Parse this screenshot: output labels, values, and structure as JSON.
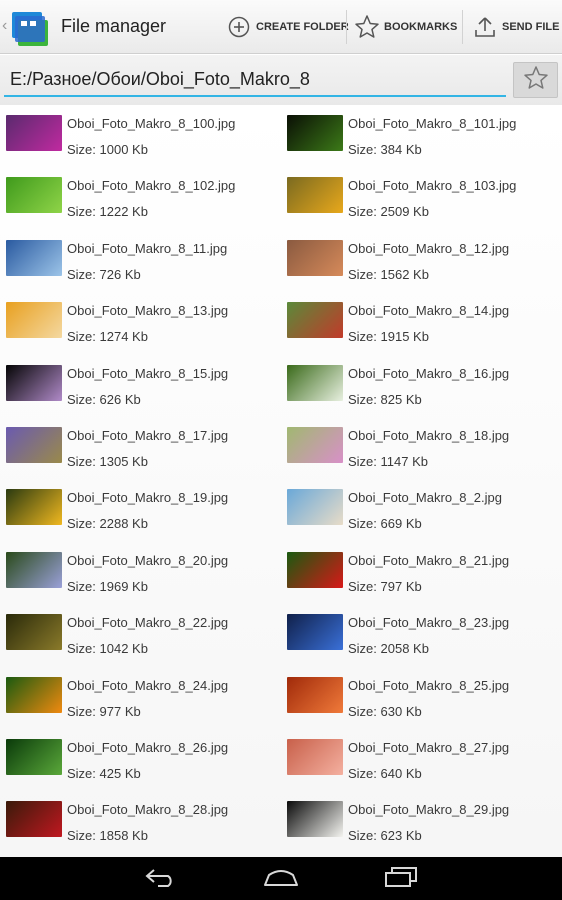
{
  "app": {
    "title": "File manager",
    "icon": "folder-app-icon"
  },
  "toolbar": {
    "create_folder_label": "CREATE FOLDER",
    "bookmarks_label": "BOOKMARKS",
    "send_file_label": "SEND FILE"
  },
  "pathbar": {
    "path": "E:/Разное/Обои/Oboi_Foto_Makro_8",
    "bookmark_icon": "star-outline-icon"
  },
  "files": [
    {
      "name": "Oboi_Foto_Makro_8_100.jpg",
      "size": "Size: 1000 Kb",
      "thumb_colors": [
        "#5a2a6e",
        "#c02aa0"
      ]
    },
    {
      "name": "Oboi_Foto_Makro_8_101.jpg",
      "size": "Size: 384 Kb",
      "thumb_colors": [
        "#0a0f05",
        "#3c7a18"
      ]
    },
    {
      "name": "Oboi_Foto_Makro_8_102.jpg",
      "size": "Size: 1222 Kb",
      "thumb_colors": [
        "#3f9a1c",
        "#8fd448"
      ]
    },
    {
      "name": "Oboi_Foto_Makro_8_103.jpg",
      "size": "Size: 2509 Kb",
      "thumb_colors": [
        "#7a6a20",
        "#e8a81c"
      ]
    },
    {
      "name": "Oboi_Foto_Makro_8_11.jpg",
      "size": "Size: 726 Kb",
      "thumb_colors": [
        "#2a5aa0",
        "#9cc4e8"
      ]
    },
    {
      "name": "Oboi_Foto_Makro_8_12.jpg",
      "size": "Size: 1562 Kb",
      "thumb_colors": [
        "#8a5a40",
        "#d68a5a"
      ]
    },
    {
      "name": "Oboi_Foto_Makro_8_13.jpg",
      "size": "Size: 1274 Kb",
      "thumb_colors": [
        "#e8a020",
        "#f4d8a0"
      ]
    },
    {
      "name": "Oboi_Foto_Makro_8_14.jpg",
      "size": "Size: 1915 Kb",
      "thumb_colors": [
        "#5a8a3a",
        "#c23a2a"
      ]
    },
    {
      "name": "Oboi_Foto_Makro_8_15.jpg",
      "size": "Size: 626 Kb",
      "thumb_colors": [
        "#050505",
        "#b08ac8"
      ]
    },
    {
      "name": "Oboi_Foto_Makro_8_16.jpg",
      "size": "Size: 825 Kb",
      "thumb_colors": [
        "#3a6a1a",
        "#e8f0e0"
      ]
    },
    {
      "name": "Oboi_Foto_Makro_8_17.jpg",
      "size": "Size: 1305 Kb",
      "thumb_colors": [
        "#6a5ab0",
        "#9a8a4a"
      ]
    },
    {
      "name": "Oboi_Foto_Makro_8_18.jpg",
      "size": "Size: 1147 Kb",
      "thumb_colors": [
        "#a0b870",
        "#d890c8"
      ]
    },
    {
      "name": "Oboi_Foto_Makro_8_19.jpg",
      "size": "Size: 2288 Kb",
      "thumb_colors": [
        "#2a3a10",
        "#f0b820"
      ]
    },
    {
      "name": "Oboi_Foto_Makro_8_2.jpg",
      "size": "Size: 669 Kb",
      "thumb_colors": [
        "#6aa8d8",
        "#e8dcc8"
      ]
    },
    {
      "name": "Oboi_Foto_Makro_8_20.jpg",
      "size": "Size: 1969 Kb",
      "thumb_colors": [
        "#2a4a1a",
        "#9aa0d8"
      ]
    },
    {
      "name": "Oboi_Foto_Makro_8_21.jpg",
      "size": "Size: 797 Kb",
      "thumb_colors": [
        "#1a5a10",
        "#d81818"
      ]
    },
    {
      "name": "Oboi_Foto_Makro_8_22.jpg",
      "size": "Size: 1042 Kb",
      "thumb_colors": [
        "#2a2a0a",
        "#8a7a2a"
      ]
    },
    {
      "name": "Oboi_Foto_Makro_8_23.jpg",
      "size": "Size: 2058 Kb",
      "thumb_colors": [
        "#10204a",
        "#3a70d8"
      ]
    },
    {
      "name": "Oboi_Foto_Makro_8_24.jpg",
      "size": "Size: 977 Kb",
      "thumb_colors": [
        "#1a5a10",
        "#f08a10"
      ]
    },
    {
      "name": "Oboi_Foto_Makro_8_25.jpg",
      "size": "Size: 630 Kb",
      "thumb_colors": [
        "#a02a0a",
        "#f07a3a"
      ]
    },
    {
      "name": "Oboi_Foto_Makro_8_26.jpg",
      "size": "Size: 425 Kb",
      "thumb_colors": [
        "#0a3a0a",
        "#5aa83a"
      ]
    },
    {
      "name": "Oboi_Foto_Makro_8_27.jpg",
      "size": "Size: 640 Kb",
      "thumb_colors": [
        "#c8604a",
        "#f4b0a0"
      ]
    },
    {
      "name": "Oboi_Foto_Makro_8_28.jpg",
      "size": "Size: 1858 Kb",
      "thumb_colors": [
        "#3a1a0a",
        "#c01820"
      ]
    },
    {
      "name": "Oboi_Foto_Makro_8_29.jpg",
      "size": "Size: 623 Kb",
      "thumb_colors": [
        "#0a0a0a",
        "#f4f4f0"
      ]
    }
  ],
  "navbar": {
    "back_icon": "back-icon",
    "home_icon": "home-icon",
    "recents_icon": "recent-apps-icon"
  },
  "colors": {
    "accent": "#33b5e5",
    "navbar": "#000000"
  }
}
